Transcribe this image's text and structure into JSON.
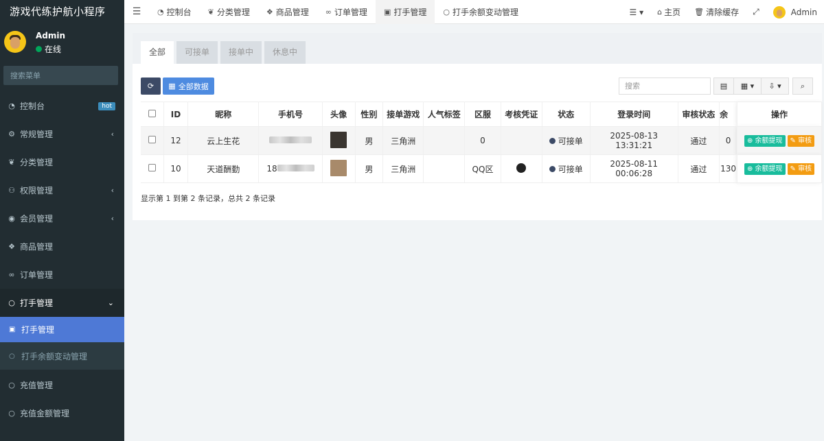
{
  "app": {
    "title": "游戏代练护航小程序"
  },
  "user": {
    "name": "Admin",
    "status": "在线"
  },
  "sidebar": {
    "search_placeholder": "搜索菜单",
    "items": [
      {
        "label": "控制台",
        "icon": "dashboard-icon",
        "badge": "hot"
      },
      {
        "label": "常规管理",
        "icon": "cogs-icon",
        "caret": "‹"
      },
      {
        "label": "分类管理",
        "icon": "leaf-icon"
      },
      {
        "label": "权限管理",
        "icon": "group-icon",
        "caret": "‹"
      },
      {
        "label": "会员管理",
        "icon": "user-circle-icon",
        "caret": "‹"
      },
      {
        "label": "商品管理",
        "icon": "cubes-icon"
      },
      {
        "label": "订单管理",
        "icon": "handshake-icon"
      },
      {
        "label": "打手管理",
        "icon": "circle-icon",
        "caret": "⌄"
      }
    ],
    "submenu": [
      {
        "label": "打手管理",
        "icon": "id-badge-icon"
      },
      {
        "label": "打手余额变动管理",
        "icon": "circle-icon"
      }
    ],
    "more_items": [
      {
        "label": "充值管理",
        "icon": "circle-icon"
      },
      {
        "label": "充值金额管理",
        "icon": "circle-icon"
      }
    ]
  },
  "topnav": {
    "tabs": [
      {
        "label": "控制台",
        "icon": "dashboard-icon"
      },
      {
        "label": "分类管理",
        "icon": "leaf-icon"
      },
      {
        "label": "商品管理",
        "icon": "cubes-icon"
      },
      {
        "label": "订单管理",
        "icon": "handshake-icon"
      },
      {
        "label": "打手管理",
        "icon": "id-badge-icon"
      },
      {
        "label": "打手余额变动管理",
        "icon": "circle-icon"
      }
    ],
    "home": "主页",
    "clear_cache": "清除缓存",
    "admin": "Admin"
  },
  "filter_tabs": [
    "全部",
    "可接单",
    "接单中",
    "休息中"
  ],
  "toolbar": {
    "all_data": "全部数据",
    "search_placeholder": "搜索"
  },
  "table": {
    "columns": [
      "ID",
      "昵称",
      "手机号",
      "头像",
      "性别",
      "接单游戏",
      "人气标签",
      "区服",
      "考核凭证",
      "状态",
      "登录时间",
      "审核状态",
      "余",
      "操作"
    ],
    "rows": [
      {
        "id": "12",
        "nickname": "云上生花",
        "gender": "男",
        "game": "三角洲",
        "tag": "",
        "server": "0",
        "status": "可接单",
        "login_time": "2025-08-13 13:31:21",
        "review": "通过",
        "balance": "0",
        "phone_prefix": ""
      },
      {
        "id": "10",
        "nickname": "天道酬勤",
        "gender": "男",
        "game": "三角洲",
        "tag": "",
        "server": "QQ区",
        "status": "可接单",
        "login_time": "2025-08-11 00:06:28",
        "review": "通过",
        "balance": "130",
        "phone_prefix": "18"
      }
    ],
    "actions": {
      "withdraw": "余额提现",
      "review": "审核"
    }
  },
  "footer": {
    "summary": "显示第 1 到第 2 条记录，总共 2 条记录"
  },
  "colors": {
    "sidebar_bg": "#222d32",
    "active_sub": "#4e79d6",
    "primary": "#4e8be0",
    "success": "#18bc9c",
    "warning": "#f39c12"
  }
}
